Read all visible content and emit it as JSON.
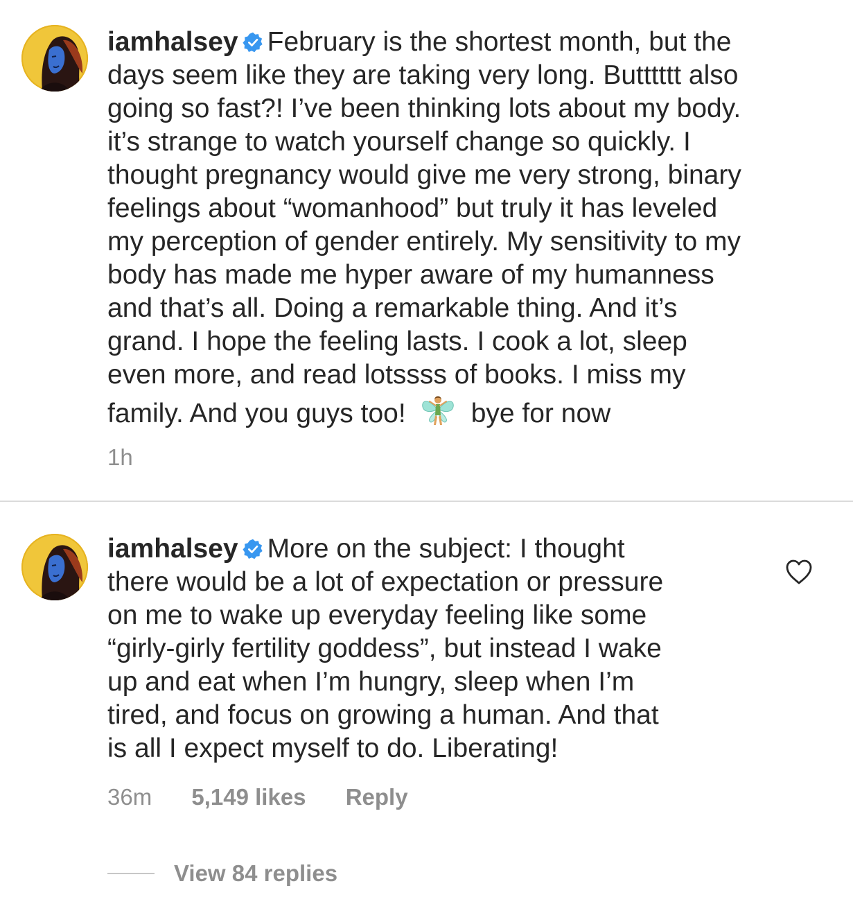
{
  "colors": {
    "text": "#262626",
    "secondary": "#8e8e8e",
    "verified_badge": "#3897f0",
    "divider": "#dbdbdb"
  },
  "comments": [
    {
      "username": "iamhalsey",
      "verified": true,
      "lines": [
        "February is the shortest month, but the",
        "days seem like they are taking very long. Butttttt also",
        "going so fast?! I’ve been thinking lots about my body.",
        "it’s strange to watch yourself change so quickly. I",
        "thought pregnancy would give me very strong, binary",
        "feelings about “womanhood” but truly it has leveled",
        "my perception of gender entirely. My sensitivity to my",
        "body has made me hyper aware of my humanness",
        "and that’s all. Doing a remarkable thing. And it’s",
        "grand. I hope the feeling lasts. I cook a lot, sleep",
        "even more, and read lotssss of books. I miss my"
      ],
      "last_line_before_emoji": "family. And you guys too!",
      "emoji": "fairy-emoji",
      "last_line_after_emoji": "bye for now",
      "time": "1h"
    },
    {
      "username": "iamhalsey",
      "verified": true,
      "lines": [
        "More on the subject: I thought",
        "there would be a lot of expectation or pressure",
        "on me to wake up everyday feeling like some",
        "“girly-girly fertility goddess”, but instead I wake",
        "up and eat when I’m hungry, sleep when I’m",
        "tired, and focus on growing a human. And that",
        "is all I expect myself to do. Liberating!"
      ],
      "time": "36m",
      "likes": "5,149 likes",
      "reply_label": "Reply",
      "like_icon": "heart-outline-icon",
      "view_replies": "View 84 replies"
    }
  ]
}
